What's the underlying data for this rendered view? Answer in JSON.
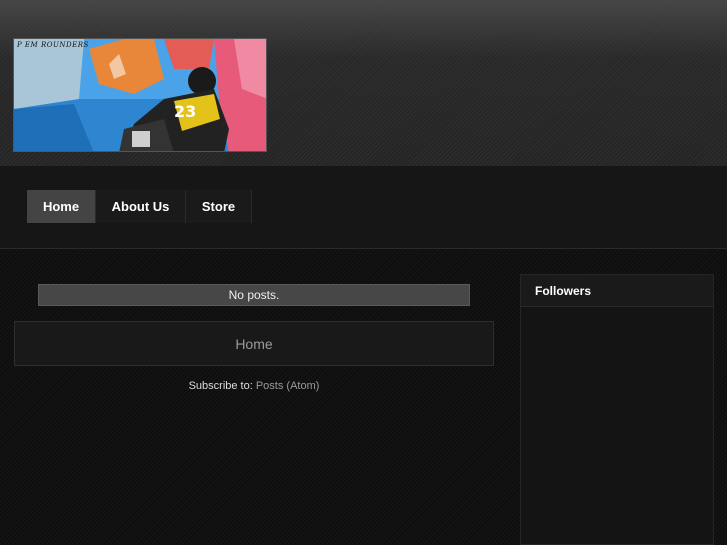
{
  "banner": {
    "caption": "P EM ROUNDERS",
    "jersey_number": "23"
  },
  "nav": {
    "items": [
      {
        "label": "Home",
        "active": true
      },
      {
        "label": "About Us",
        "active": false
      },
      {
        "label": "Store",
        "active": false
      }
    ]
  },
  "main": {
    "no_posts": "No posts.",
    "home_link": "Home",
    "subscribe_label": "Subscribe to:",
    "subscribe_link": "Posts (Atom)"
  },
  "sidebar": {
    "followers_title": "Followers"
  },
  "colors": {
    "active_nav": "#444444",
    "link_grey": "#9a9a9a"
  }
}
